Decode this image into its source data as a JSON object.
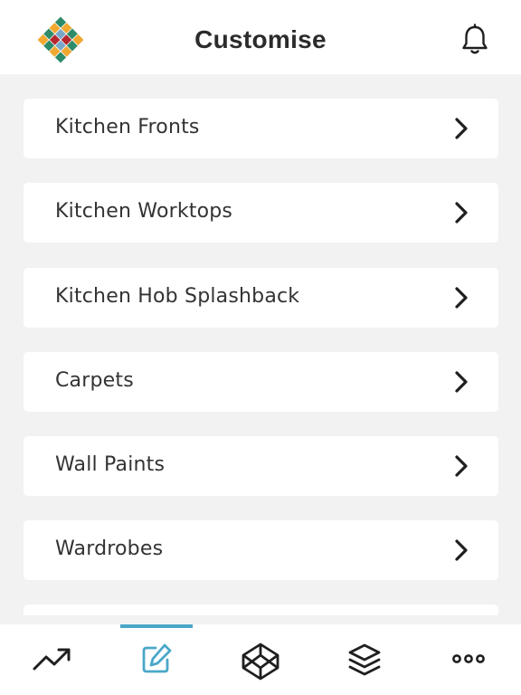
{
  "header": {
    "title": "Customise",
    "logo_icon": "diamond-mosaic-logo",
    "notification_icon": "bell-icon"
  },
  "menu": {
    "items": [
      {
        "label": "Kitchen Fronts"
      },
      {
        "label": "Kitchen Worktops"
      },
      {
        "label": "Kitchen Hob Splashback"
      },
      {
        "label": "Carpets"
      },
      {
        "label": "Wall Paints"
      },
      {
        "label": "Wardrobes"
      },
      {
        "label": ""
      }
    ],
    "chevron_icon": "chevron-right-icon"
  },
  "tabbar": {
    "active_index": 1,
    "accent_color": "#4aa7c9",
    "tabs": [
      {
        "icon": "trending-up-icon"
      },
      {
        "icon": "edit-icon"
      },
      {
        "icon": "codepen-cube-icon"
      },
      {
        "icon": "layers-icon"
      },
      {
        "icon": "more-dots-icon"
      }
    ]
  },
  "colors": {
    "background": "#f2f2f2",
    "card": "#ffffff",
    "text": "#333333",
    "title": "#2b2b2b",
    "accent": "#4aa7c9",
    "logo_green": "#2e8b6a",
    "logo_orange": "#f0a830",
    "logo_red": "#b5272d",
    "logo_blue": "#7aa7c7"
  }
}
